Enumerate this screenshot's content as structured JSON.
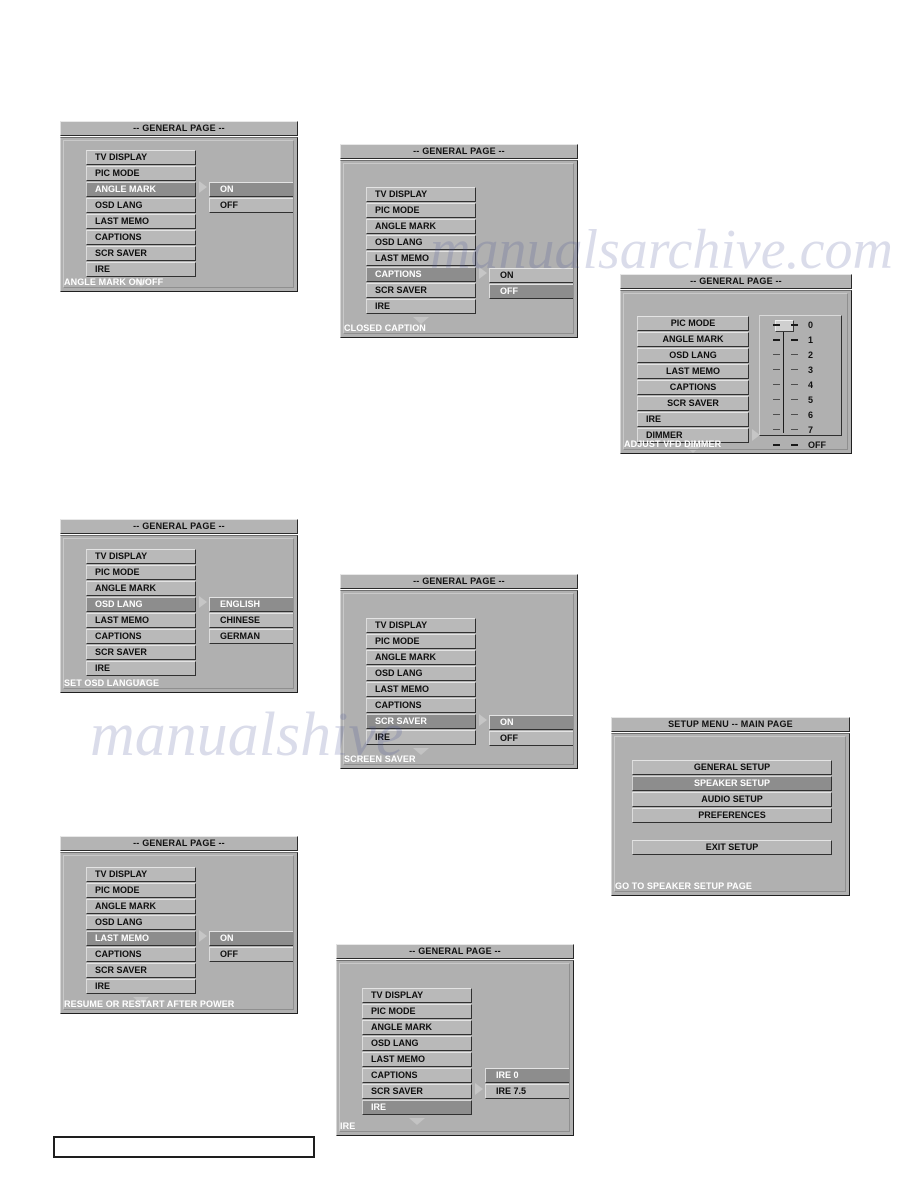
{
  "page": {
    "background": "#ffffff",
    "panel_bg": "#b0b0b0",
    "item_bg": "#b9b9b9",
    "selected_bg": "#8d8d8d",
    "selected_text": "#ffffff",
    "text": "#0d0d0d"
  },
  "watermarks": [
    {
      "text": "manualsarchive.com"
    },
    {
      "text": "manualshive"
    }
  ],
  "panels": [
    {
      "id": "angle-mark",
      "title": "-- GENERAL PAGE --",
      "status": "ANGLE MARK ON/OFF",
      "menu": [
        {
          "label": "TV DISPLAY",
          "selected": false
        },
        {
          "label": "PIC MODE",
          "selected": false
        },
        {
          "label": "ANGLE MARK",
          "selected": true
        },
        {
          "label": "OSD LANG",
          "selected": false
        },
        {
          "label": "LAST MEMO",
          "selected": false
        },
        {
          "label": "CAPTIONS",
          "selected": false
        },
        {
          "label": "SCR SAVER",
          "selected": false
        },
        {
          "label": "IRE",
          "selected": false
        }
      ],
      "submenu": [
        {
          "label": "ON",
          "selected": true
        },
        {
          "label": "OFF",
          "selected": false
        }
      ],
      "submenu_anchor_index": 2
    },
    {
      "id": "closed-caption",
      "title": "-- GENERAL PAGE --",
      "status": "CLOSED CAPTION",
      "menu": [
        {
          "label": "TV DISPLAY",
          "selected": false
        },
        {
          "label": "PIC MODE",
          "selected": false
        },
        {
          "label": "ANGLE MARK",
          "selected": false
        },
        {
          "label": "OSD LANG",
          "selected": false
        },
        {
          "label": "LAST MEMO",
          "selected": false
        },
        {
          "label": "CAPTIONS",
          "selected": true
        },
        {
          "label": "SCR SAVER",
          "selected": false
        },
        {
          "label": "IRE",
          "selected": false
        }
      ],
      "submenu": [
        {
          "label": "ON",
          "selected": false
        },
        {
          "label": "OFF",
          "selected": true
        }
      ],
      "submenu_anchor_index": 5
    },
    {
      "id": "dimmer",
      "title": "-- GENERAL PAGE --",
      "status": "ADJUST VFD DIMMER",
      "menu": [
        {
          "label": "PIC MODE",
          "selected": false
        },
        {
          "label": "ANGLE MARK",
          "selected": false
        },
        {
          "label": "OSD LANG",
          "selected": false
        },
        {
          "label": "LAST MEMO",
          "selected": false
        },
        {
          "label": "CAPTIONS",
          "selected": false
        },
        {
          "label": "SCR SAVER",
          "selected": false
        },
        {
          "label": "IRE",
          "selected": false
        },
        {
          "label": "DIMMER",
          "selected": true
        }
      ],
      "slider": {
        "levels": [
          "0",
          "1",
          "2",
          "3",
          "4",
          "5",
          "6",
          "7",
          "OFF"
        ],
        "current": "0"
      }
    },
    {
      "id": "osd-lang",
      "title": "-- GENERAL PAGE --",
      "status": "SET OSD LANGUAGE",
      "menu": [
        {
          "label": "TV DISPLAY",
          "selected": false
        },
        {
          "label": "PIC MODE",
          "selected": false
        },
        {
          "label": "ANGLE MARK",
          "selected": false
        },
        {
          "label": "OSD LANG",
          "selected": true
        },
        {
          "label": "LAST MEMO",
          "selected": false
        },
        {
          "label": "CAPTIONS",
          "selected": false
        },
        {
          "label": "SCR SAVER",
          "selected": false
        },
        {
          "label": "IRE",
          "selected": false
        }
      ],
      "submenu": [
        {
          "label": "ENGLISH",
          "selected": true
        },
        {
          "label": "CHINESE",
          "selected": false
        },
        {
          "label": "GERMAN",
          "selected": false
        }
      ],
      "submenu_anchor_index": 3
    },
    {
      "id": "screen-saver",
      "title": "-- GENERAL PAGE --",
      "status": "SCREEN SAVER",
      "menu": [
        {
          "label": "TV DISPLAY",
          "selected": false
        },
        {
          "label": "PIC MODE",
          "selected": false
        },
        {
          "label": "ANGLE MARK",
          "selected": false
        },
        {
          "label": "OSD LANG",
          "selected": false
        },
        {
          "label": "LAST MEMO",
          "selected": false
        },
        {
          "label": "CAPTIONS",
          "selected": false
        },
        {
          "label": "SCR SAVER",
          "selected": true
        },
        {
          "label": "IRE",
          "selected": false
        }
      ],
      "submenu": [
        {
          "label": "ON",
          "selected": true
        },
        {
          "label": "OFF",
          "selected": false
        }
      ],
      "submenu_anchor_index": 6
    },
    {
      "id": "setup-main",
      "title": "SETUP MENU -- MAIN PAGE",
      "status": "GO TO SPEAKER SETUP PAGE",
      "menu": [
        {
          "label": "GENERAL SETUP",
          "selected": false
        },
        {
          "label": "SPEAKER SETUP",
          "selected": true
        },
        {
          "label": "AUDIO SETUP",
          "selected": false
        },
        {
          "label": "PREFERENCES",
          "selected": false
        },
        {
          "label": "EXIT SETUP",
          "selected": false
        }
      ]
    },
    {
      "id": "last-memo",
      "title": "-- GENERAL PAGE --",
      "status": "RESUME OR RESTART AFTER POWER",
      "menu": [
        {
          "label": "TV DISPLAY",
          "selected": false
        },
        {
          "label": "PIC MODE",
          "selected": false
        },
        {
          "label": "ANGLE MARK",
          "selected": false
        },
        {
          "label": "OSD LANG",
          "selected": false
        },
        {
          "label": "LAST MEMO",
          "selected": true
        },
        {
          "label": "CAPTIONS",
          "selected": false
        },
        {
          "label": "SCR SAVER",
          "selected": false
        },
        {
          "label": "IRE",
          "selected": false
        }
      ],
      "submenu": [
        {
          "label": "ON",
          "selected": true
        },
        {
          "label": "OFF",
          "selected": false
        }
      ],
      "submenu_anchor_index": 4
    },
    {
      "id": "ire",
      "title": "-- GENERAL PAGE --",
      "status": "IRE",
      "menu": [
        {
          "label": "TV DISPLAY",
          "selected": false
        },
        {
          "label": "PIC MODE",
          "selected": false
        },
        {
          "label": "ANGLE MARK",
          "selected": false
        },
        {
          "label": "OSD LANG",
          "selected": false
        },
        {
          "label": "LAST MEMO",
          "selected": false
        },
        {
          "label": "CAPTIONS",
          "selected": false
        },
        {
          "label": "SCR SAVER",
          "selected": false
        },
        {
          "label": "IRE",
          "selected": true
        }
      ],
      "submenu": [
        {
          "label": "IRE 0",
          "selected": true
        },
        {
          "label": "IRE 7.5",
          "selected": false
        }
      ],
      "submenu_anchor_index": 6
    }
  ]
}
